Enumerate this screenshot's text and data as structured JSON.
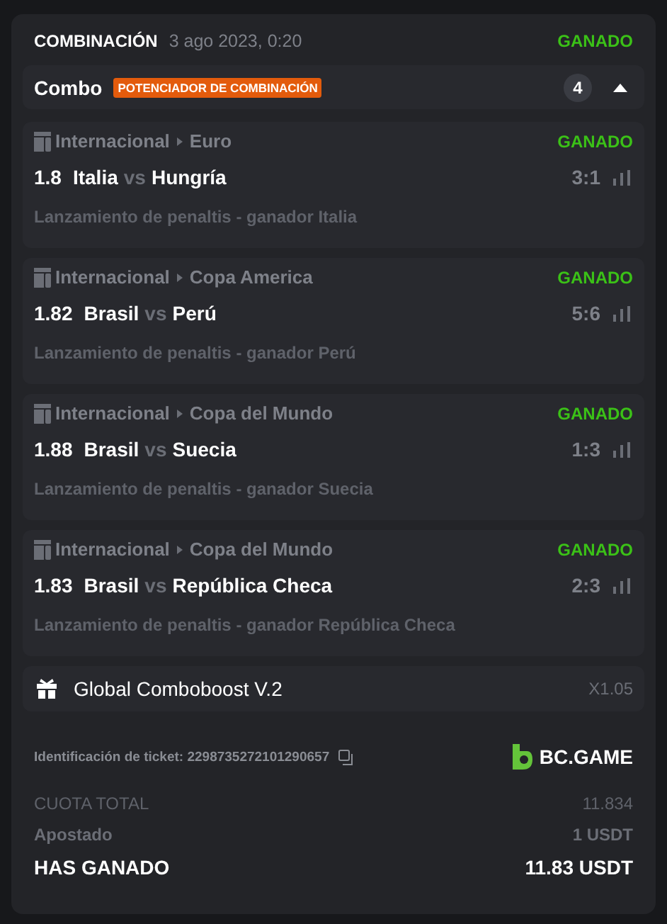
{
  "header": {
    "title": "COMBINACIÓN",
    "date": "3 ago 2023, 0:20",
    "status": "GANADO"
  },
  "combo": {
    "label": "Combo",
    "badge": "POTENCIADOR DE COMBINACIÓN",
    "count": "4",
    "expanded": true
  },
  "selections": [
    {
      "category": "Internacional",
      "league": "Euro",
      "status": "GANADO",
      "odds": "1.8",
      "home": "Italia",
      "vs": "vs",
      "away": "Hungría",
      "score": "3:1",
      "market": "Lanzamiento de penaltis - ganador Italia"
    },
    {
      "category": "Internacional",
      "league": "Copa America",
      "status": "GANADO",
      "odds": "1.82",
      "home": "Brasil",
      "vs": "vs",
      "away": "Perú",
      "score": "5:6",
      "market": "Lanzamiento de penaltis - ganador Perú"
    },
    {
      "category": "Internacional",
      "league": "Copa del Mundo",
      "status": "GANADO",
      "odds": "1.88",
      "home": "Brasil",
      "vs": "vs",
      "away": "Suecia",
      "score": "1:3",
      "market": "Lanzamiento de penaltis - ganador Suecia"
    },
    {
      "category": "Internacional",
      "league": "Copa del Mundo",
      "status": "GANADO",
      "odds": "1.83",
      "home": "Brasil",
      "vs": "vs",
      "away": "República Checa",
      "score": "2:3",
      "market": "Lanzamiento de penaltis - ganador República Checa"
    }
  ],
  "boost": {
    "label": "Global Comboboost V.2",
    "multiplier": "X1.05"
  },
  "ticket": {
    "label": "Identificación de ticket: 2298735272101290657",
    "brand": "BC.GAME"
  },
  "totals": [
    {
      "kind": "muted",
      "label": "CUOTA TOTAL",
      "value": "11.834"
    },
    {
      "kind": "semibold",
      "label": "Apostado",
      "value": "1 USDT"
    },
    {
      "kind": "total",
      "label": "HAS GANADO",
      "value": "11.83 USDT"
    }
  ]
}
